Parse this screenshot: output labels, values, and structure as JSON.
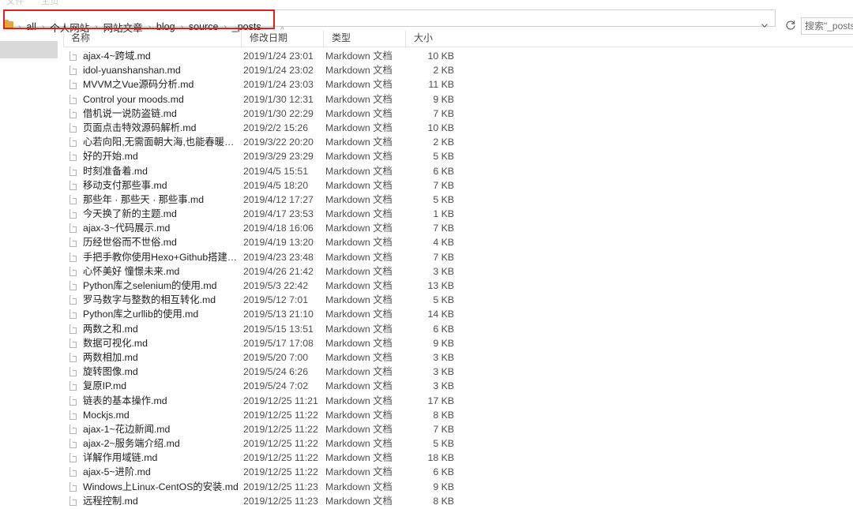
{
  "window": {
    "ribbon_ghost_left": "文件",
    "ribbon_ghost_right": "主页"
  },
  "address_bar": {
    "folder_icon": "folder-icon",
    "breadcrumbs": [
      "all",
      "个人网站",
      "网站文章",
      "blog",
      "source",
      "_posts"
    ],
    "separator": "›",
    "dropdown_icon": "chevron-down-icon",
    "refresh_icon": "refresh-icon",
    "search_value": "搜索\"_posts",
    "search_placeholder": "搜索\"_posts"
  },
  "highlight": {
    "color": "#e02020"
  },
  "columns": {
    "name": "名称",
    "date": "修改日期",
    "type": "类型",
    "size": "大小",
    "sort_caret": "^",
    "sorted_by": "修改日期"
  },
  "files": [
    {
      "name": "ajax-4~跨域.md",
      "date": "2019/1/24 23:01",
      "type": "Markdown 文档",
      "size": "10 KB"
    },
    {
      "name": "idol-yuanshanshan.md",
      "date": "2019/1/24 23:02",
      "type": "Markdown 文档",
      "size": "2 KB"
    },
    {
      "name": "MVVM之Vue源码分析.md",
      "date": "2019/1/24 23:03",
      "type": "Markdown 文档",
      "size": "11 KB"
    },
    {
      "name": "Control your moods.md",
      "date": "2019/1/30 12:31",
      "type": "Markdown 文档",
      "size": "9 KB"
    },
    {
      "name": "借机说一说防盗链.md",
      "date": "2019/1/30 22:29",
      "type": "Markdown 文档",
      "size": "7 KB"
    },
    {
      "name": "页面点击特效源码解析.md",
      "date": "2019/2/2 15:26",
      "type": "Markdown 文档",
      "size": "10 KB"
    },
    {
      "name": "心若向阳,无需面朝大海,也能春暖花开.md",
      "date": "2019/3/22 20:20",
      "type": "Markdown 文档",
      "size": "2 KB"
    },
    {
      "name": "好的开始.md",
      "date": "2019/3/29 23:29",
      "type": "Markdown 文档",
      "size": "5 KB"
    },
    {
      "name": "时刻准备着.md",
      "date": "2019/4/5 15:51",
      "type": "Markdown 文档",
      "size": "6 KB"
    },
    {
      "name": "移动支付那些事.md",
      "date": "2019/4/5 18:20",
      "type": "Markdown 文档",
      "size": "7 KB"
    },
    {
      "name": "那些年 · 那些天 · 那些事.md",
      "date": "2019/4/12 17:27",
      "type": "Markdown 文档",
      "size": "5 KB"
    },
    {
      "name": "今天换了新的主题.md",
      "date": "2019/4/17 23:53",
      "type": "Markdown 文档",
      "size": "1 KB"
    },
    {
      "name": "ajax-3~代码展示.md",
      "date": "2019/4/18 16:06",
      "type": "Markdown 文档",
      "size": "7 KB"
    },
    {
      "name": "历经世俗而不世俗.md",
      "date": "2019/4/19 13:20",
      "type": "Markdown 文档",
      "size": "4 KB"
    },
    {
      "name": "手把手教你使用Hexo+Github搭建个人...",
      "date": "2019/4/23 23:48",
      "type": "Markdown 文档",
      "size": "7 KB"
    },
    {
      "name": "心怀美好 憧憬未来.md",
      "date": "2019/4/26 21:42",
      "type": "Markdown 文档",
      "size": "3 KB"
    },
    {
      "name": "Python库之selenium的使用.md",
      "date": "2019/5/3 22:42",
      "type": "Markdown 文档",
      "size": "13 KB"
    },
    {
      "name": "罗马数字与整数的相互转化.md",
      "date": "2019/5/12 7:01",
      "type": "Markdown 文档",
      "size": "5 KB"
    },
    {
      "name": "Python库之urllib的使用.md",
      "date": "2019/5/13 21:10",
      "type": "Markdown 文档",
      "size": "14 KB"
    },
    {
      "name": "两数之和.md",
      "date": "2019/5/15 13:51",
      "type": "Markdown 文档",
      "size": "6 KB"
    },
    {
      "name": "数据可视化.md",
      "date": "2019/5/17 17:08",
      "type": "Markdown 文档",
      "size": "9 KB"
    },
    {
      "name": "两数相加.md",
      "date": "2019/5/20 7:00",
      "type": "Markdown 文档",
      "size": "3 KB"
    },
    {
      "name": "旋转图像.md",
      "date": "2019/5/24 6:26",
      "type": "Markdown 文档",
      "size": "3 KB"
    },
    {
      "name": "复原IP.md",
      "date": "2019/5/24 7:02",
      "type": "Markdown 文档",
      "size": "3 KB"
    },
    {
      "name": "链表的基本操作.md",
      "date": "2019/12/25 11:21",
      "type": "Markdown 文档",
      "size": "17 KB"
    },
    {
      "name": "Mockjs.md",
      "date": "2019/12/25 11:22",
      "type": "Markdown 文档",
      "size": "8 KB"
    },
    {
      "name": "ajax-1~花边新闻.md",
      "date": "2019/12/25 11:22",
      "type": "Markdown 文档",
      "size": "7 KB"
    },
    {
      "name": "ajax-2~服务端介绍.md",
      "date": "2019/12/25 11:22",
      "type": "Markdown 文档",
      "size": "5 KB"
    },
    {
      "name": "详解作用域链.md",
      "date": "2019/12/25 11:22",
      "type": "Markdown 文档",
      "size": "18 KB"
    },
    {
      "name": "ajax-5~进阶.md",
      "date": "2019/12/25 11:22",
      "type": "Markdown 文档",
      "size": "6 KB"
    },
    {
      "name": "Windows上Linux-CentOS的安装.md",
      "date": "2019/12/25 11:23",
      "type": "Markdown 文档",
      "size": "9 KB"
    },
    {
      "name": "远程控制.md",
      "date": "2019/12/25 11:23",
      "type": "Markdown 文档",
      "size": "8 KB"
    }
  ]
}
